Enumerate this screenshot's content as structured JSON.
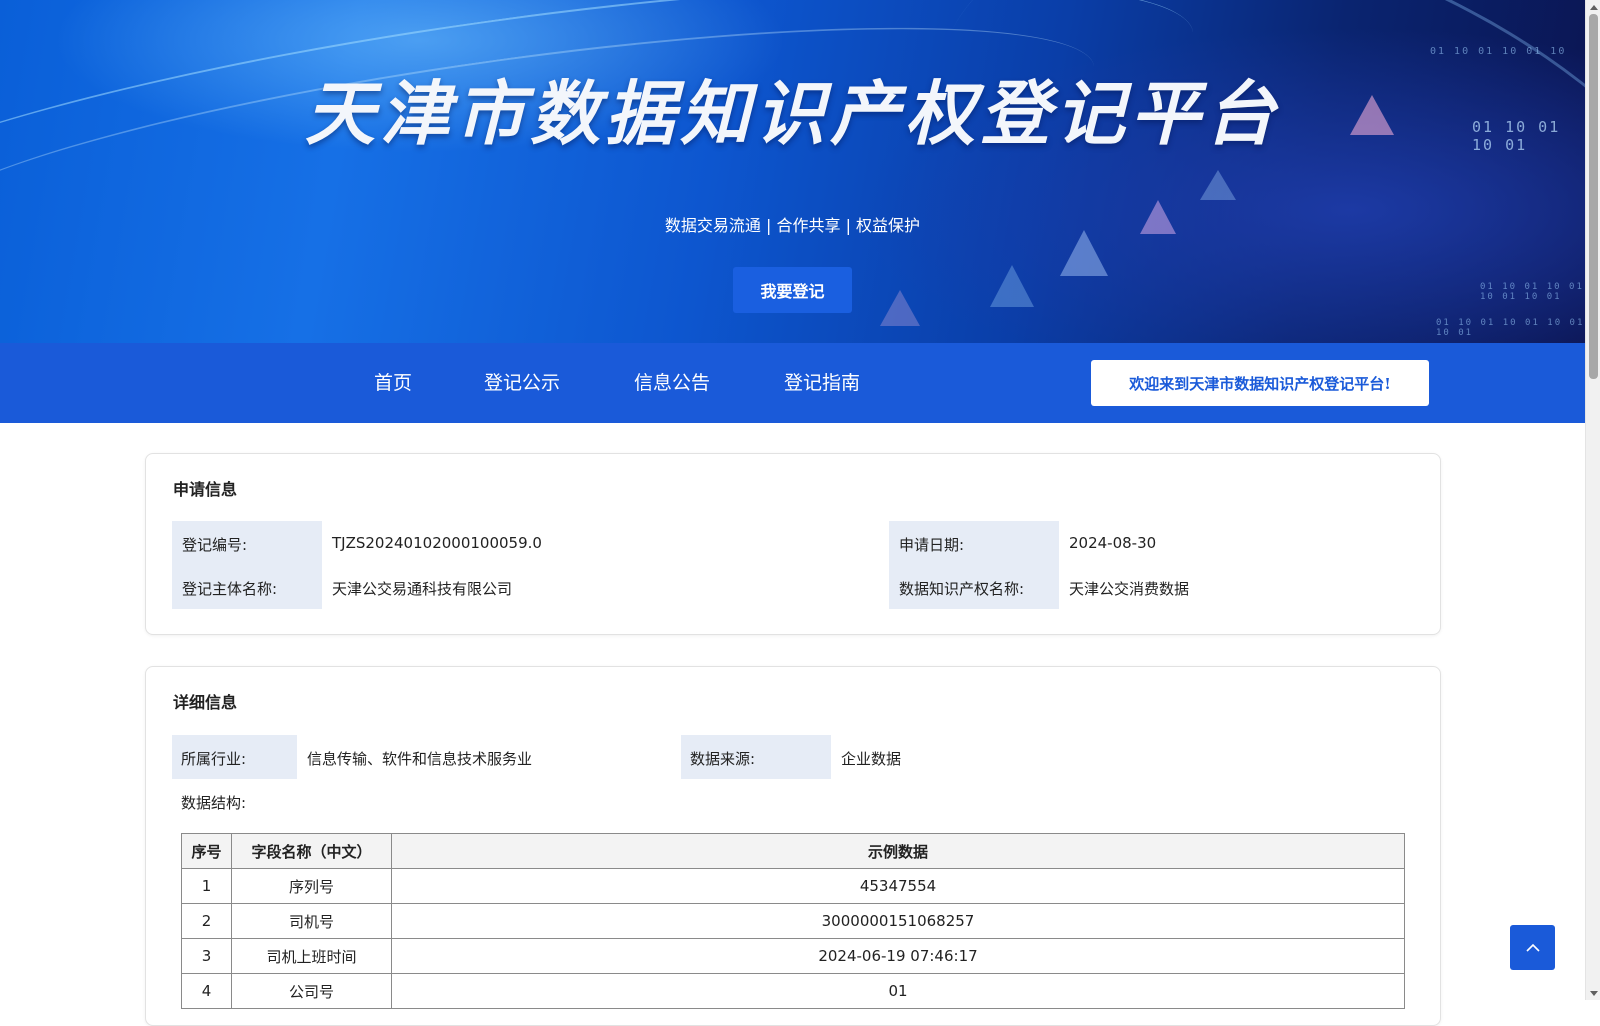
{
  "banner": {
    "title": "天津市数据知识产权登记平台",
    "slogan": "数据交易流通 | 合作共享 | 权益保护",
    "register_button": "我要登记",
    "decor_bits": [
      "01 10 01 10 01 10",
      "01 10 01 10 01",
      "01 10 01 10 01 10 01 10 01",
      "01 10 01 10 01 10 01 10 01"
    ]
  },
  "nav": {
    "items": [
      "首页",
      "登记公示",
      "信息公告",
      "登记指南"
    ],
    "welcome": "欢迎来到天津市数据知识产权登记平台!"
  },
  "application_info": {
    "title": "申请信息",
    "reg_no_label": "登记编号:",
    "reg_no_value": "TJZS20240102000100059.0",
    "apply_date_label": "申请日期:",
    "apply_date_value": "2024-08-30",
    "subject_label": "登记主体名称:",
    "subject_value": "天津公交易通科技有限公司",
    "ip_name_label": "数据知识产权名称:",
    "ip_name_value": "天津公交消费数据"
  },
  "detail_info": {
    "title": "详细信息",
    "industry_label": "所属行业:",
    "industry_value": "信息传输、软件和信息技术服务业",
    "source_label": "数据来源:",
    "source_value": "企业数据",
    "structure_label": "数据结构:",
    "table": {
      "headers": [
        "序号",
        "字段名称（中文）",
        "示例数据"
      ],
      "rows": [
        [
          "1",
          "序列号",
          "45347554"
        ],
        [
          "2",
          "司机号",
          "3000000151068257"
        ],
        [
          "3",
          "司机上班时间",
          "2024-06-19 07:46:17"
        ],
        [
          "4",
          "公司号",
          "01"
        ]
      ]
    }
  },
  "colors": {
    "primary": "#1a5ad9",
    "label_bg": "#e6ecf6"
  },
  "icons": {
    "back_to_top": "chevron-up-icon"
  }
}
